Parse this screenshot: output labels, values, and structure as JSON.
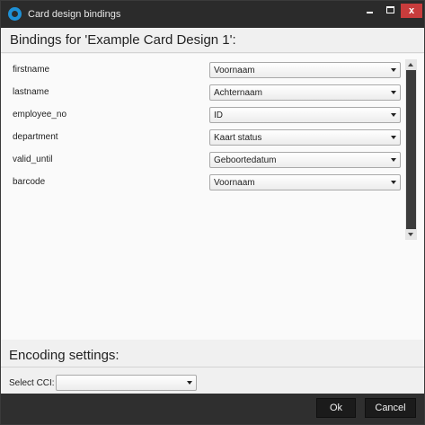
{
  "window": {
    "title": "Card design bindings",
    "controls": {
      "minimize": "",
      "maximize": "",
      "close": "x"
    }
  },
  "header": {
    "title": "Bindings for 'Example Card Design 1':"
  },
  "bindings": [
    {
      "field": "firstname",
      "value": "Voornaam"
    },
    {
      "field": "lastname",
      "value": "Achternaam"
    },
    {
      "field": "employee_no",
      "value": "ID"
    },
    {
      "field": "department",
      "value": "Kaart status"
    },
    {
      "field": "valid_until",
      "value": "Geboortedatum"
    },
    {
      "field": "barcode",
      "value": "Voornaam"
    }
  ],
  "encoding": {
    "title": "Encoding settings:",
    "cci_label": "Select CCI:",
    "cci_value": ""
  },
  "footer": {
    "ok_label": "Ok",
    "cancel_label": "Cancel"
  },
  "colors": {
    "titlebar": "#2b2b2b",
    "accent": "#1e90d6",
    "close_button": "#c83c3c",
    "footer": "#2f2f2f"
  }
}
